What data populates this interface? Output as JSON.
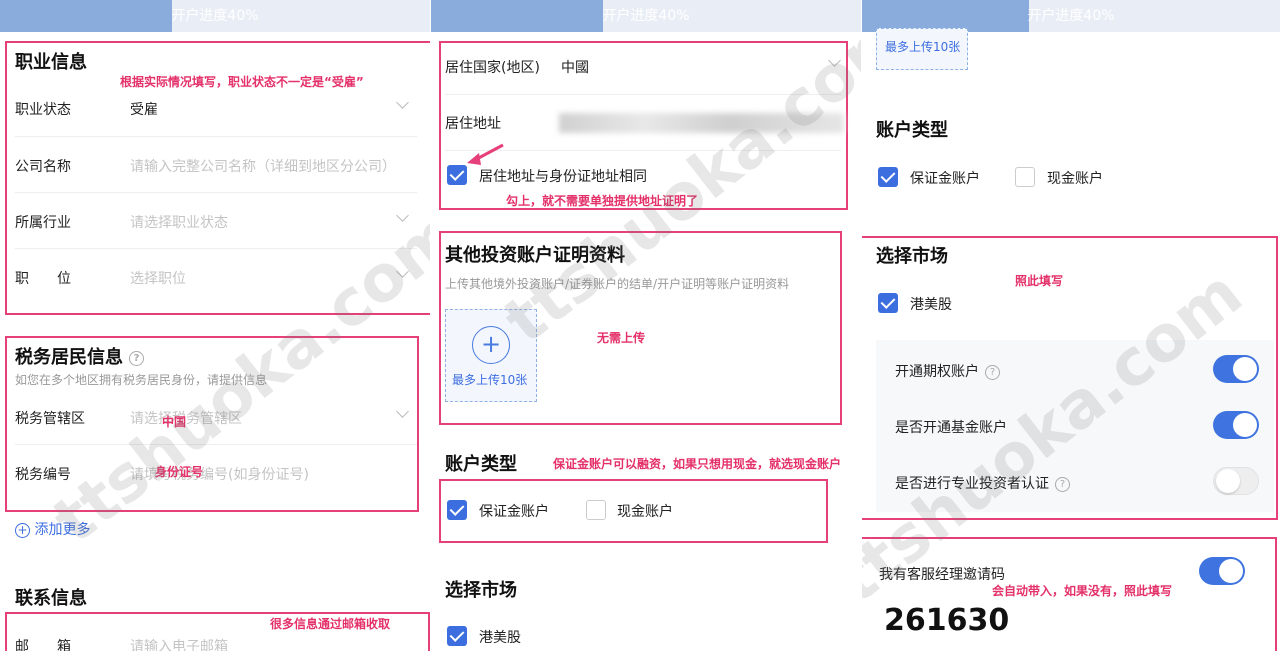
{
  "progress": {
    "label": "开户进度40%",
    "value": 0.4
  },
  "colors": {
    "accent": "#3d6ee0",
    "annotation": "#e6407a",
    "progress_bar": "#8aacdc"
  },
  "watermark": "ttshuoka.com",
  "panel1": {
    "occupation": {
      "title": "职业信息",
      "note": "根据实际情况填写，职业状态不一定是“受雇”",
      "status_label": "职业状态",
      "status_value": "受雇",
      "company_label": "公司名称",
      "company_placeholder": "请输入完整公司名称（详细到地区分公司）",
      "industry_label": "所属行业",
      "industry_placeholder": "请选择职业状态",
      "position_label": "职　　位",
      "position_placeholder": "选择职位"
    },
    "tax": {
      "title": "税务居民信息",
      "subtitle": "如您在多个地区拥有税务居民身份，请提供信息",
      "jurisdiction_label": "税务管辖区",
      "jurisdiction_placeholder": "请选择税务管辖区",
      "jurisdiction_note": "中国",
      "number_label": "税务编号",
      "number_placeholder": "请填写税务编号(如身份证号)",
      "number_note": "身份证号",
      "add_more": "添加更多"
    },
    "contact": {
      "title": "联系信息",
      "note": "很多信息通过邮箱收取",
      "email_label": "邮　　箱",
      "email_placeholder": "请输入电子邮箱"
    }
  },
  "panel2": {
    "residence": {
      "country_label": "居住国家(地区)",
      "country_value": "中國",
      "address_label": "居住地址",
      "same_address_label": "居住地址与身份证地址相同",
      "same_address_checked": true,
      "note": "勾上，就不需要单独提供地址证明了"
    },
    "other_accounts": {
      "title": "其他投资账户证明资料",
      "subtitle": "上传其他境外投资账户/证券账户的结单/开户证明等账户证明资料",
      "upload_label": "最多上传10张",
      "note": "无需上传"
    },
    "account_type": {
      "title": "账户类型",
      "note": "保证金账户可以融资，如果只想用现金，就选现金账户",
      "margin_label": "保证金账户",
      "margin_checked": true,
      "cash_label": "现金账户",
      "cash_checked": false
    },
    "market": {
      "title": "选择市场",
      "hk_us_label": "港美股",
      "hk_us_checked": true
    }
  },
  "panel3": {
    "upload_label": "最多上传10张",
    "account_type": {
      "title": "账户类型",
      "margin_label": "保证金账户",
      "margin_checked": true,
      "cash_label": "现金账户",
      "cash_checked": false
    },
    "market": {
      "title": "选择市场",
      "note": "照此填写",
      "hk_us_label": "港美股",
      "hk_us_checked": true,
      "options_label": "开通期权账户",
      "options_on": true,
      "fund_label": "是否开通基金账户",
      "fund_on": true,
      "pro_label": "是否进行专业投资者认证",
      "pro_on": false
    },
    "invite": {
      "label": "我有客服经理邀请码",
      "on": true,
      "note": "会自动带入，如果没有，照此填写",
      "code": "261630"
    }
  }
}
